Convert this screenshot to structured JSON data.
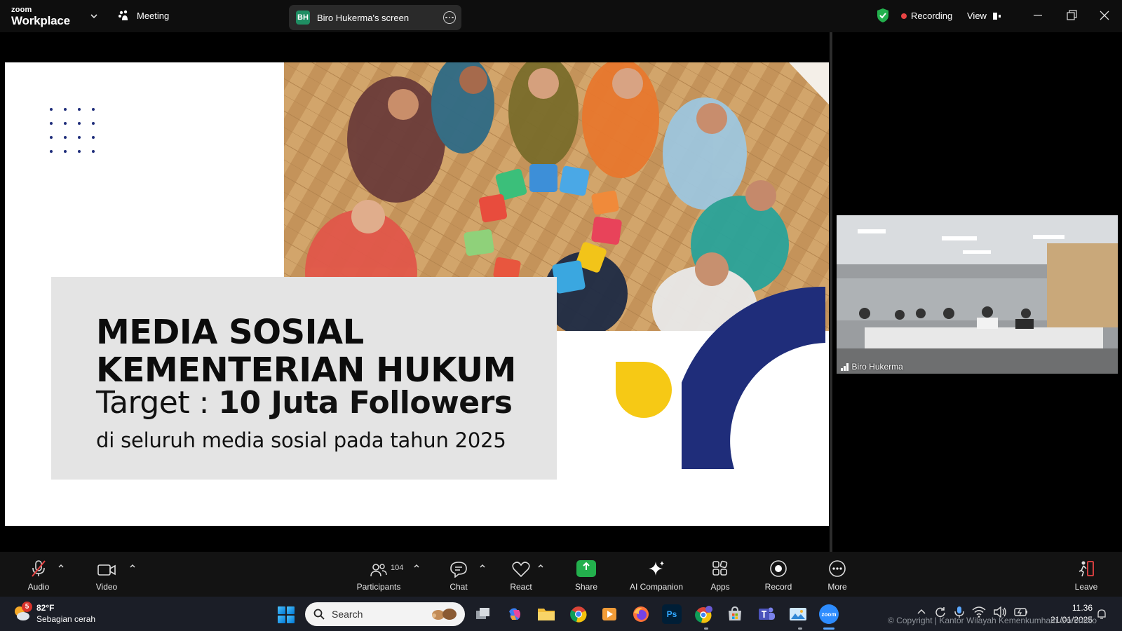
{
  "titlebar": {
    "brand_small": "zoom",
    "brand_big": "Workplace",
    "meeting_label": "Meeting",
    "screen_share_avatar": "BH",
    "screen_share_label": "Biro Hukerma's screen",
    "recording_label": "Recording",
    "view_label": "View"
  },
  "slide": {
    "title_line1": "MEDIA SOSIAL",
    "title_line2": "KEMENTERIAN HUKUM",
    "target_prefix": "Target : ",
    "target_value": "10 Juta Followers",
    "subtitle": "di seluruh media sosial pada tahun 2025",
    "accent_navy": "#1f2d7a",
    "accent_yellow": "#f6c915"
  },
  "video_tile": {
    "participant_name": "Biro Hukerma"
  },
  "toolbar": {
    "audio": "Audio",
    "video": "Video",
    "participants": "Participants",
    "participants_count": "104",
    "chat": "Chat",
    "react": "React",
    "share": "Share",
    "ai_companion": "AI Companion",
    "apps": "Apps",
    "record": "Record",
    "more": "More",
    "leave": "Leave",
    "share_color": "#23b04d"
  },
  "taskbar": {
    "weather_badge": "5",
    "temperature": "82°F",
    "weather_desc": "Sebagian cerah",
    "search_placeholder": "Search",
    "apps": [
      "task-view-icon",
      "copilot-icon",
      "file-explorer-icon",
      "chrome-icon",
      "media-player-icon",
      "firefox-icon",
      "photoshop-icon",
      "chrome-profile-icon",
      "store-icon",
      "teams-icon",
      "photos-icon",
      "zoom-icon"
    ],
    "photoshop_label": "Ps",
    "zoom_label": "zoom",
    "time": "11.36",
    "date": "21/01/2025"
  },
  "watermark": {
    "copyright": "© Copyright | Kantor Wilayah Kemenkumham Gorontalo"
  }
}
